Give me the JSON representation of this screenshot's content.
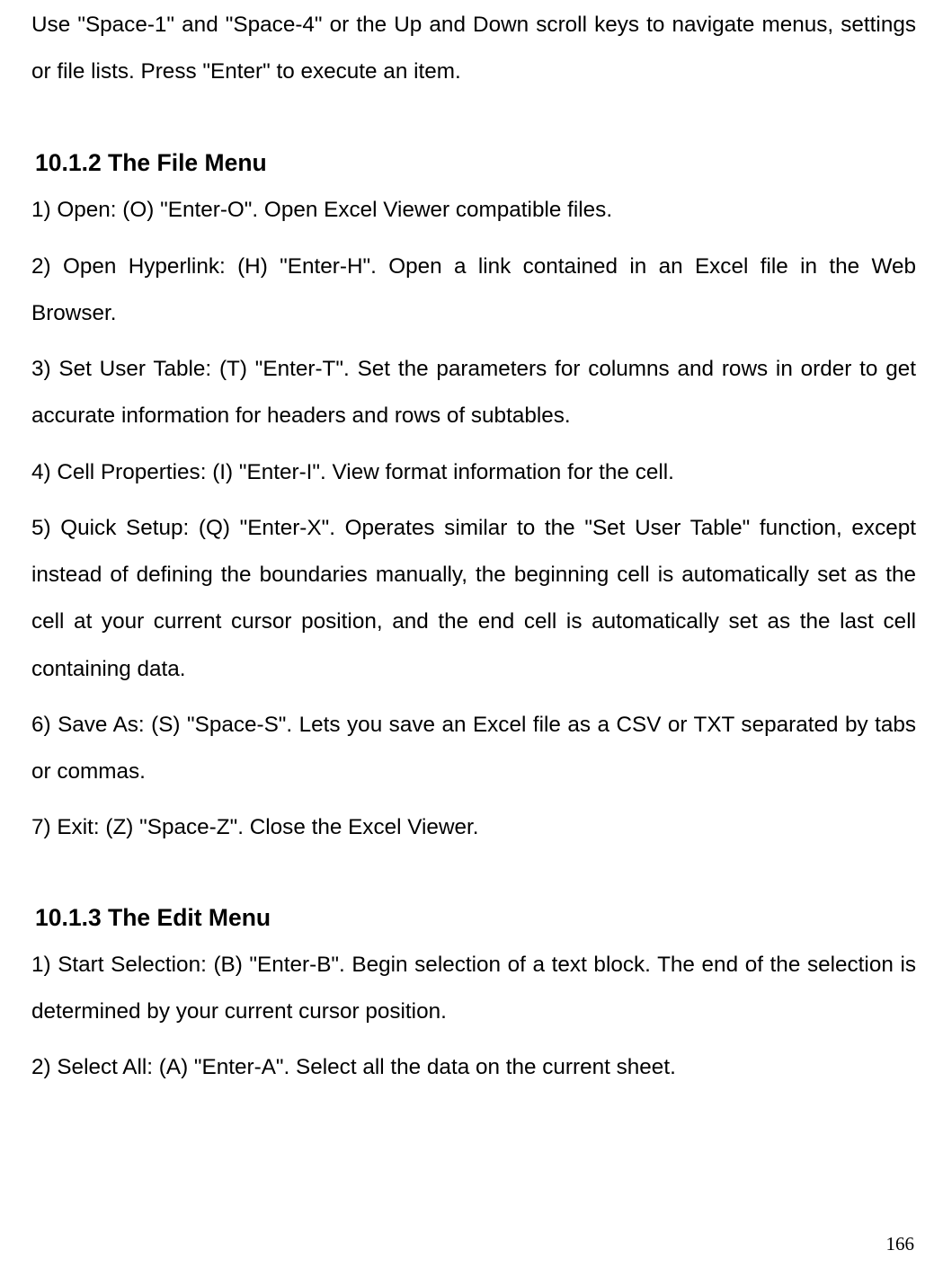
{
  "intro": "Use \"Space-1\" and \"Space-4\" or the Up and Down scroll keys to navigate menus, settings or file lists. Press \"Enter\" to execute an item.",
  "section1": {
    "heading": "10.1.2 The File Menu",
    "items": [
      "1) Open: (O) \"Enter-O\". Open Excel Viewer compatible files.",
      "2) Open Hyperlink: (H) \"Enter-H\". Open a link contained in an Excel file in the Web Browser.",
      "3) Set User Table: (T) \"Enter-T\". Set the parameters for columns and rows in order to get accurate information for headers and rows of subtables.",
      "4) Cell Properties: (I) \"Enter-I\". View format information for the cell.",
      "5) Quick Setup: (Q) \"Enter-X\". Operates similar to the \"Set User Table\" function, except instead of defining the boundaries manually, the beginning cell is automatically set as the cell at your current cursor position, and the end cell is automatically set as the last cell containing data.",
      "6) Save As: (S) \"Space-S\". Lets you save an Excel file as a CSV or TXT separated by tabs or commas.",
      "7) Exit: (Z) \"Space-Z\". Close the Excel Viewer."
    ]
  },
  "section2": {
    "heading": "10.1.3 The Edit Menu",
    "items": [
      "1) Start Selection: (B) \"Enter-B\". Begin selection of a text block. The end of the selection is determined by your current cursor position.",
      "2) Select All: (A) \"Enter-A\". Select all the data on the current sheet."
    ]
  },
  "pageNumber": "166"
}
